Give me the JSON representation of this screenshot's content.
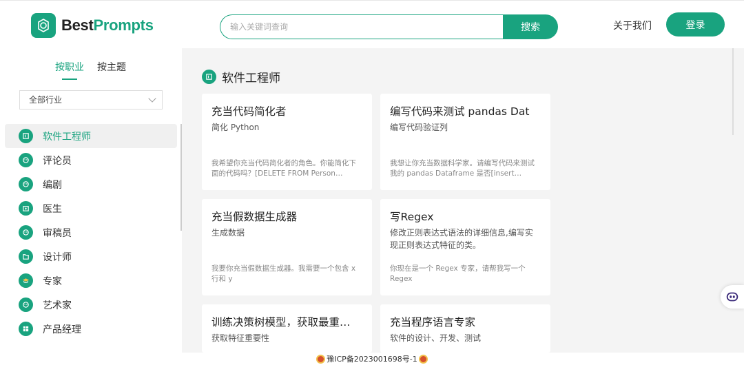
{
  "header": {
    "logo_part1": "Best",
    "logo_part2": "Prompts",
    "search_placeholder": "输入关键词查询",
    "search_button": "搜索",
    "about": "关于我们",
    "login": "登录",
    "brand_color": "#19a37f"
  },
  "sidebar": {
    "tabs": [
      {
        "label": "按职业",
        "active": true
      },
      {
        "label": "按主题",
        "active": false
      }
    ],
    "industry_select": "全部行业",
    "items": [
      {
        "label": "软件工程师",
        "icon": "code-icon",
        "active": true
      },
      {
        "label": "评论员",
        "icon": "comment-icon"
      },
      {
        "label": "编剧",
        "icon": "script-icon"
      },
      {
        "label": "医生",
        "icon": "medical-icon"
      },
      {
        "label": "审稿员",
        "icon": "review-icon"
      },
      {
        "label": "设计师",
        "icon": "design-icon"
      },
      {
        "label": "专家",
        "icon": "graduation-cap-icon"
      },
      {
        "label": "艺术家",
        "icon": "palette-icon"
      },
      {
        "label": "产品经理",
        "icon": "grid-icon"
      }
    ]
  },
  "main": {
    "section_title": "软件工程师",
    "cards": [
      {
        "title": "充当代码简化者",
        "subtitle": "简化 Python",
        "desc": "我希望你充当代码简化者的角色。你能简化下面的代码吗？[DELETE FROM Person…"
      },
      {
        "title": "编写代码来测试 pandas Dat",
        "subtitle": "编写代码验证列",
        "desc": "我想让你充当数据科学家。请编写代码来测试我的 pandas Dataframe 是否[insert…"
      },
      {
        "title": "充当假数据生成器",
        "subtitle": "生成数据",
        "desc": "我要你充当假数据生成器。我需要一个包含 x 行和 y"
      },
      {
        "title": "写Regex",
        "subtitle": "修改正则表达式语法的详细信息,编写实现正则表达式特征的类。",
        "desc": "你现在是一个 Regex 专家，请帮我写一个 Regex"
      },
      {
        "title": "训练决策树模型，获取最重…",
        "subtitle": "获取特征重要性",
        "desc": ""
      },
      {
        "title": "充当程序语言专家",
        "subtitle": "软件的设计、开发、测试",
        "desc": ""
      }
    ]
  },
  "footer": {
    "icp": "豫ICP备2023001698号-1"
  }
}
